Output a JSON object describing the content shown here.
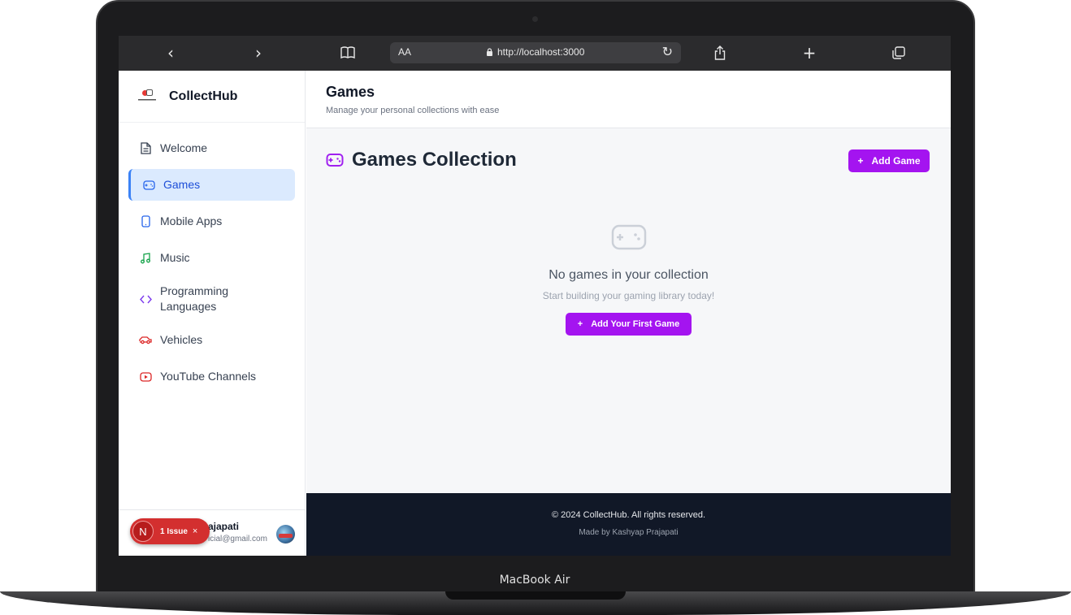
{
  "device": {
    "label": "MacBook Air"
  },
  "browser": {
    "text_size_label": "AA",
    "url": "http://localhost:3000"
  },
  "sidebar": {
    "brand": "CollectHub",
    "items": [
      {
        "label": "Welcome",
        "icon": "document-icon",
        "color": "#374151"
      },
      {
        "label": "Games",
        "icon": "gamepad-icon",
        "color": "#2563eb",
        "active": true
      },
      {
        "label": "Mobile Apps",
        "icon": "smartphone-icon",
        "color": "#2563eb"
      },
      {
        "label": "Music",
        "icon": "music-note-icon",
        "color": "#16a34a"
      },
      {
        "label": "Programming Languages",
        "icon": "code-icon",
        "color": "#7c3aed"
      },
      {
        "label": "Vehicles",
        "icon": "car-icon",
        "color": "#dc2626"
      },
      {
        "label": "YouTube Channels",
        "icon": "youtube-icon",
        "color": "#dc2626"
      }
    ],
    "user": {
      "name": "ajapati",
      "email": "icial@gmail.com"
    },
    "issue_badge": {
      "initial": "N",
      "text": "1 Issue",
      "close": "×"
    }
  },
  "header": {
    "title": "Games",
    "subtitle": "Manage your personal collections with ease"
  },
  "main": {
    "section_title": "Games Collection",
    "add_button": "Add Game",
    "empty": {
      "title": "No games in your collection",
      "subtitle": "Start building your gaming library today!",
      "button": "Add Your First Game"
    }
  },
  "footer": {
    "copyright": "© 2024 CollectHub. All rights reserved.",
    "made_by": "Made by Kashyap Prajapati"
  },
  "colors": {
    "accent": "#a414f0",
    "active_bg": "#dbeafe",
    "footer_bg": "#111827"
  }
}
